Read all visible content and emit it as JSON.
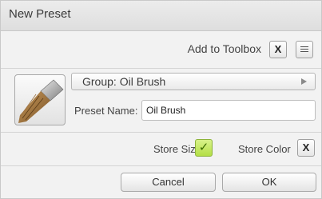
{
  "dialog": {
    "title": "New Preset",
    "add_to_toolbox": {
      "label": "Add to Toolbox",
      "toggle_text": "X",
      "checked": false
    },
    "preset_icon": "oil-brush-icon",
    "group": {
      "label": "Group: Oil Brush",
      "arrow_icon": "triangle-right-icon"
    },
    "preset_name": {
      "label": "Preset Name:",
      "value": "Oil Brush"
    },
    "store_size": {
      "label": "Store Size",
      "toggle_text": "✓",
      "checked": true
    },
    "store_color": {
      "label": "Store Color",
      "toggle_text": "X",
      "checked": false
    },
    "buttons": {
      "cancel": "Cancel",
      "ok": "OK"
    },
    "colors": {
      "check_green": "#b4df46"
    }
  }
}
